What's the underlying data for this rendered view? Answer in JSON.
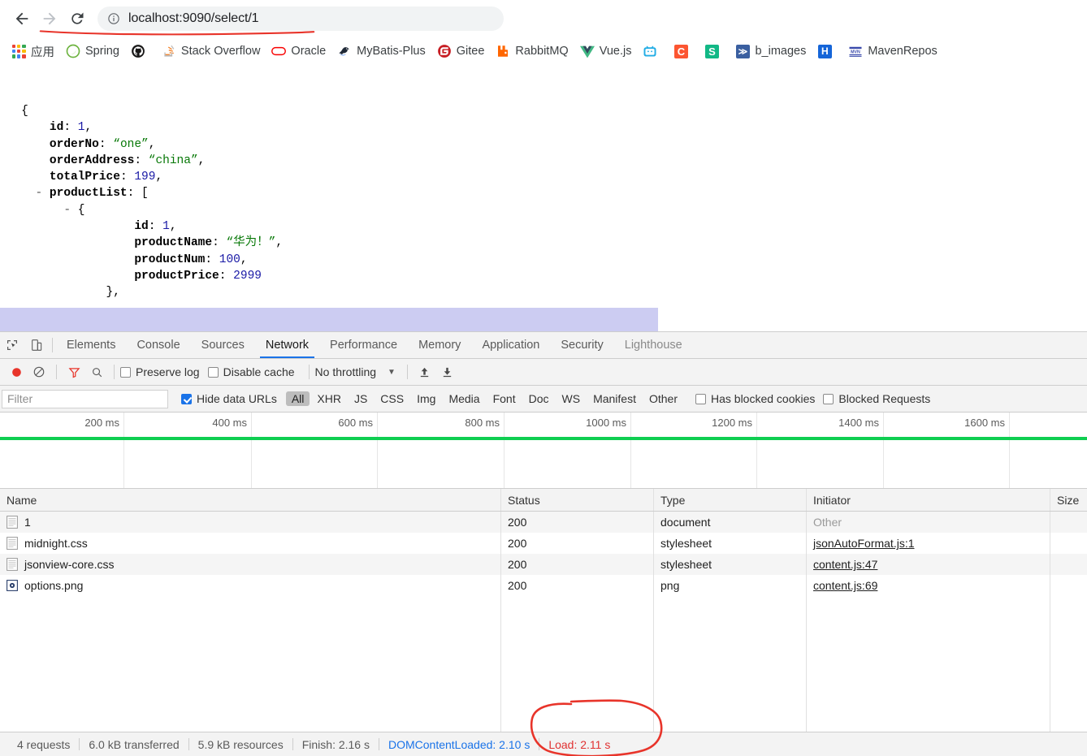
{
  "browser": {
    "back_label": "Back",
    "forward_label": "Forward",
    "reload_label": "Reload",
    "info_icon": "info-circle-icon",
    "url_prefix": "localhost",
    "url_port": ":9090",
    "url_path": "/select/1",
    "url_full": "localhost:9090/select/1",
    "annotation_color": "#e8342a"
  },
  "bookmarks": [
    {
      "label": "应用",
      "icon": "apps-grid-icon",
      "type": "grid"
    },
    {
      "label": "Spring",
      "icon": "spring-leaf-icon",
      "type": "spring",
      "color": "#6db33f"
    },
    {
      "label": "",
      "icon": "github-icon",
      "type": "github",
      "color": "#181717"
    },
    {
      "label": "Stack Overflow",
      "icon": "stackoverflow-icon",
      "type": "so",
      "color": "#f48024"
    },
    {
      "label": "Oracle",
      "icon": "oracle-icon",
      "type": "oracle",
      "color": "#f80000"
    },
    {
      "label": "MyBatis-Plus",
      "icon": "mybatis-bird-icon",
      "type": "mybatis",
      "color": "#222222"
    },
    {
      "label": "Gitee",
      "icon": "gitee-icon",
      "type": "sqround",
      "color": "#c71d23",
      "glyph": "G"
    },
    {
      "label": "RabbitMQ",
      "icon": "rabbitmq-icon",
      "type": "rabbit",
      "color": "#ff6600"
    },
    {
      "label": "Vue.js",
      "icon": "vuejs-icon",
      "type": "vue",
      "color": "#41b883"
    },
    {
      "label": "",
      "icon": "bilibili-icon",
      "type": "bili",
      "color": "#23ade5"
    },
    {
      "label": "",
      "icon": "csdn-icon",
      "type": "sq",
      "color": "#fc5531",
      "glyph": "C"
    },
    {
      "label": "",
      "icon": "segmentfault-icon",
      "type": "sq",
      "color": "#12b886",
      "glyph": "S"
    },
    {
      "label": "b_images",
      "icon": "bimages-icon",
      "type": "sq",
      "color": "#3a5fa0",
      "glyph": "≫"
    },
    {
      "label": "",
      "icon": "hexo-icon",
      "type": "sq",
      "color": "#1565d8",
      "glyph": "H"
    },
    {
      "label": "MavenRepos",
      "icon": "maven-icon",
      "type": "maven",
      "color": "#3949ab"
    }
  ],
  "json_view": {
    "lines": [
      {
        "indent": 0,
        "toggle": "",
        "parts": [
          {
            "t": "punc",
            "v": "{"
          }
        ]
      },
      {
        "indent": 1,
        "toggle": "",
        "parts": [
          {
            "t": "key",
            "v": "id"
          },
          {
            "t": "punc",
            "v": ": "
          },
          {
            "t": "num",
            "v": "1"
          },
          {
            "t": "punc",
            "v": ","
          }
        ]
      },
      {
        "indent": 1,
        "toggle": "",
        "parts": [
          {
            "t": "key",
            "v": "orderNo"
          },
          {
            "t": "punc",
            "v": ": "
          },
          {
            "t": "str",
            "v": "“one”"
          },
          {
            "t": "punc",
            "v": ","
          }
        ]
      },
      {
        "indent": 1,
        "toggle": "",
        "parts": [
          {
            "t": "key",
            "v": "orderAddress"
          },
          {
            "t": "punc",
            "v": ": "
          },
          {
            "t": "str",
            "v": "“china”"
          },
          {
            "t": "punc",
            "v": ","
          }
        ]
      },
      {
        "indent": 1,
        "toggle": "",
        "parts": [
          {
            "t": "key",
            "v": "totalPrice"
          },
          {
            "t": "punc",
            "v": ": "
          },
          {
            "t": "num",
            "v": "199"
          },
          {
            "t": "punc",
            "v": ","
          }
        ]
      },
      {
        "indent": 1,
        "toggle": "-",
        "parts": [
          {
            "t": "key",
            "v": "productList"
          },
          {
            "t": "punc",
            "v": ": ["
          }
        ]
      },
      {
        "indent": 2,
        "toggle": "-",
        "parts": [
          {
            "t": "punc",
            "v": "{"
          }
        ]
      },
      {
        "indent": 4,
        "toggle": "",
        "parts": [
          {
            "t": "key",
            "v": "id"
          },
          {
            "t": "punc",
            "v": ": "
          },
          {
            "t": "num",
            "v": "1"
          },
          {
            "t": "punc",
            "v": ","
          }
        ]
      },
      {
        "indent": 4,
        "toggle": "",
        "parts": [
          {
            "t": "key",
            "v": "productName"
          },
          {
            "t": "punc",
            "v": ": "
          },
          {
            "t": "str",
            "v": "“华为！”"
          },
          {
            "t": "punc",
            "v": ","
          }
        ]
      },
      {
        "indent": 4,
        "toggle": "",
        "parts": [
          {
            "t": "key",
            "v": "productNum"
          },
          {
            "t": "punc",
            "v": ": "
          },
          {
            "t": "num",
            "v": "100"
          },
          {
            "t": "punc",
            "v": ","
          }
        ]
      },
      {
        "indent": 4,
        "toggle": "",
        "parts": [
          {
            "t": "key",
            "v": "productPrice"
          },
          {
            "t": "punc",
            "v": ": "
          },
          {
            "t": "num",
            "v": "2999"
          }
        ]
      },
      {
        "indent": 3,
        "toggle": "",
        "parts": [
          {
            "t": "punc",
            "v": "},"
          }
        ]
      }
    ],
    "selection_color": "#ccccf2"
  },
  "devtools": {
    "inspect_icon": "inspect-element-icon",
    "device_icon": "device-toolbar-icon",
    "tabs": [
      {
        "label": "Elements",
        "active": false
      },
      {
        "label": "Console",
        "active": false
      },
      {
        "label": "Sources",
        "active": false
      },
      {
        "label": "Network",
        "active": true
      },
      {
        "label": "Performance",
        "active": false
      },
      {
        "label": "Memory",
        "active": false
      },
      {
        "label": "Application",
        "active": false
      },
      {
        "label": "Security",
        "active": false
      },
      {
        "label": "Lighthouse",
        "active": false
      }
    ],
    "active_tab_color": "#1a73e8",
    "toolbar": {
      "record_icon": "record-button-icon",
      "record_color": "#e8342a",
      "clear_icon": "clear-prohibited-icon",
      "filter_icon": "filter-funnel-icon",
      "filter_icon_color": "#e8342a",
      "search_icon": "search-icon",
      "preserve_log_label": "Preserve log",
      "preserve_log_checked": false,
      "disable_cache_label": "Disable cache",
      "disable_cache_checked": false,
      "throttling_label": "No throttling",
      "throttling_caret": "▼",
      "import_icon": "import-har-icon",
      "export_icon": "export-har-icon"
    },
    "filterbar": {
      "filter_placeholder": "Filter",
      "filter_value": "",
      "hide_data_urls_label": "Hide data URLs",
      "hide_data_urls_checked": true,
      "types": [
        {
          "label": "All",
          "selected": true
        },
        {
          "label": "XHR",
          "selected": false
        },
        {
          "label": "JS",
          "selected": false
        },
        {
          "label": "CSS",
          "selected": false
        },
        {
          "label": "Img",
          "selected": false
        },
        {
          "label": "Media",
          "selected": false
        },
        {
          "label": "Font",
          "selected": false
        },
        {
          "label": "Doc",
          "selected": false
        },
        {
          "label": "WS",
          "selected": false
        },
        {
          "label": "Manifest",
          "selected": false
        },
        {
          "label": "Other",
          "selected": false
        }
      ],
      "has_blocked_cookies_label": "Has blocked cookies",
      "has_blocked_cookies_checked": false,
      "blocked_requests_label": "Blocked Requests",
      "blocked_requests_checked": false
    },
    "overview": {
      "ticks": [
        "200 ms",
        "400 ms",
        "600 ms",
        "800 ms",
        "1000 ms",
        "1200 ms",
        "1400 ms",
        "1600 ms"
      ],
      "tick_positions": [
        152,
        309,
        464,
        620,
        776,
        931,
        1087,
        1242
      ],
      "line_color": "#0fce51"
    },
    "table": {
      "columns": [
        "Name",
        "Status",
        "Type",
        "Initiator",
        "Size"
      ],
      "rows": [
        {
          "name": "1",
          "icon": "document-file-icon",
          "status": "200",
          "type": "document",
          "initiator": "Other",
          "initiator_link": false,
          "size": ""
        },
        {
          "name": "midnight.css",
          "icon": "stylesheet-file-icon",
          "status": "200",
          "type": "stylesheet",
          "initiator": "jsonAutoFormat.js:1",
          "initiator_link": true,
          "size": ""
        },
        {
          "name": "jsonview-core.css",
          "icon": "stylesheet-file-icon",
          "status": "200",
          "type": "stylesheet",
          "initiator": "content.js:47",
          "initiator_link": true,
          "size": ""
        },
        {
          "name": "options.png",
          "icon": "image-file-icon",
          "status": "200",
          "type": "png",
          "initiator": "content.js:69",
          "initiator_link": true,
          "size": ""
        }
      ]
    },
    "status_bar": {
      "requests": "4 requests",
      "transferred": "6.0 kB transferred",
      "resources": "5.9 kB resources",
      "finish": "Finish: 2.16 s",
      "dom_content_loaded": "DOMContentLoaded: 2.10 s",
      "dom_content_loaded_color": "#1a73e8",
      "load": "Load: 2.11 s",
      "load_color": "#e03131"
    }
  },
  "annotations": {
    "url_underline_color": "#e8342a",
    "load_circle_color": "#e8342a"
  }
}
